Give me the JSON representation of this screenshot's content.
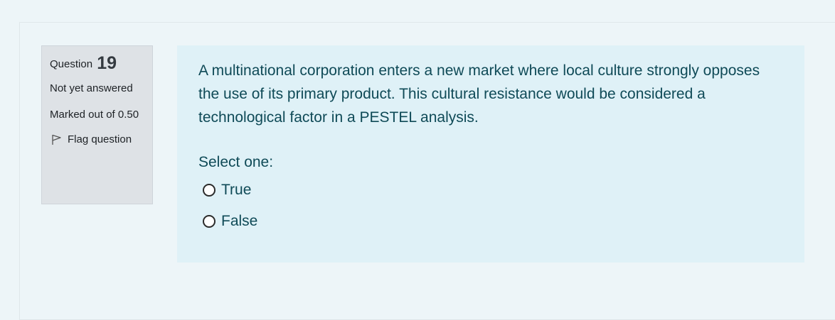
{
  "question": {
    "label": "Question",
    "number": "19",
    "state": "Not yet answered",
    "grade": "Marked out of 0.50",
    "flag_label": "Flag question",
    "flag_icon": "flag-icon"
  },
  "content": {
    "text": "A multinational corporation enters a new market where local culture strongly opposes the use of its primary product. This cultural resistance would be considered a technological factor in a PESTEL analysis.",
    "prompt": "Select one:",
    "options": [
      {
        "label": "True"
      },
      {
        "label": "False"
      }
    ]
  }
}
